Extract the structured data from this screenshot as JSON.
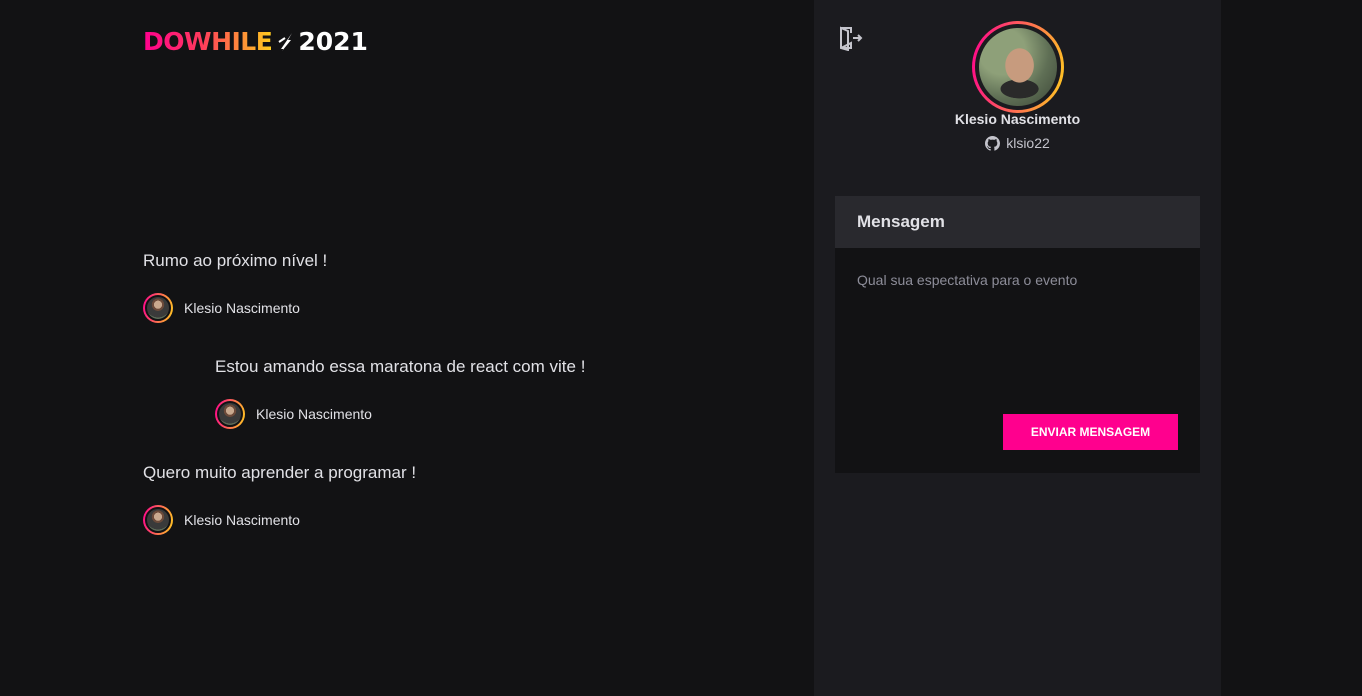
{
  "logo": {
    "brand": "DOWHILE",
    "year": "2021"
  },
  "messages": [
    {
      "content": "Rumo ao próximo nível !",
      "author": "Klesio Nascimento"
    },
    {
      "content": "Estou amando essa maratona de react com vite !",
      "author": "Klesio Nascimento"
    },
    {
      "content": "Quero muito aprender a programar !",
      "author": "Klesio Nascimento"
    }
  ],
  "profile": {
    "name": "Klesio Nascimento",
    "github_login": "klsio22"
  },
  "form": {
    "title": "Mensagem",
    "placeholder": "Qual sua espectativa para o evento",
    "value": "",
    "submit_label": "ENVIAR MENSAGEM"
  },
  "icons": {
    "signout": "sign-out-icon",
    "github": "github-icon"
  },
  "colors": {
    "accent": "#ff008e",
    "gradient_end": "#ffcd1e",
    "background": "#121214",
    "panel": "#1b1b1f"
  }
}
